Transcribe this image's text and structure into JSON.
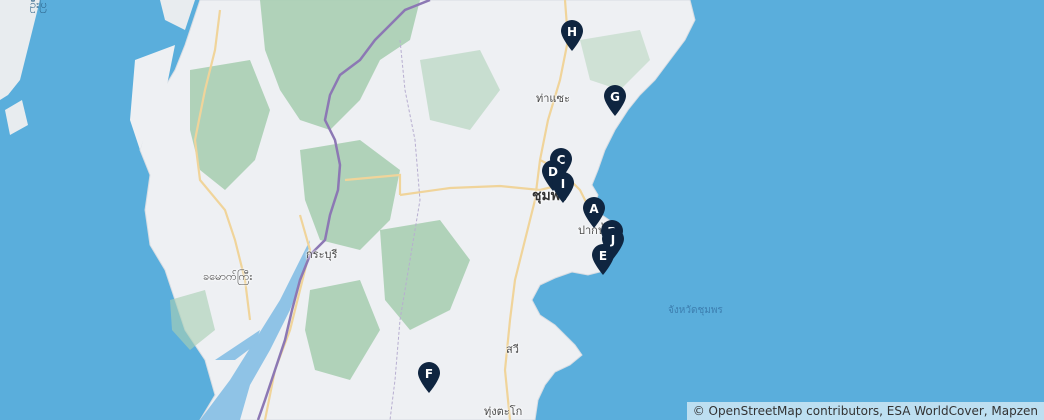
{
  "map": {
    "place_labels": {
      "thachae": "ท่าแซะ",
      "chumphon": "ชุมพร",
      "paknam": "ปากน้ำ",
      "kraburi": "กระบุรี",
      "myanmar_town": "ခမောက်ကြီး",
      "sawi": "สวี",
      "thungtako": "ทุ่งตะโก",
      "province_sea": "จังหวัดชุมพร",
      "myanmar_corner": "ဦးပြ"
    },
    "markers": [
      {
        "id": "H",
        "label": "H"
      },
      {
        "id": "G",
        "label": "G"
      },
      {
        "id": "C",
        "label": "C"
      },
      {
        "id": "D",
        "label": "D"
      },
      {
        "id": "I",
        "label": "I"
      },
      {
        "id": "A",
        "label": "A"
      },
      {
        "id": "B",
        "label": "B"
      },
      {
        "id": "J",
        "label": "J"
      },
      {
        "id": "E",
        "label": "E"
      },
      {
        "id": "F",
        "label": "F"
      }
    ],
    "attribution": "© OpenStreetMap contributors, ESA WorldCover, Mapzen",
    "colors": {
      "sea": "#5aaedc",
      "land": "#eef0f3",
      "forest": "#a9cfb3",
      "road": "#f2d9a4",
      "border": "#8c78b4",
      "marker": "#0f2540"
    }
  }
}
